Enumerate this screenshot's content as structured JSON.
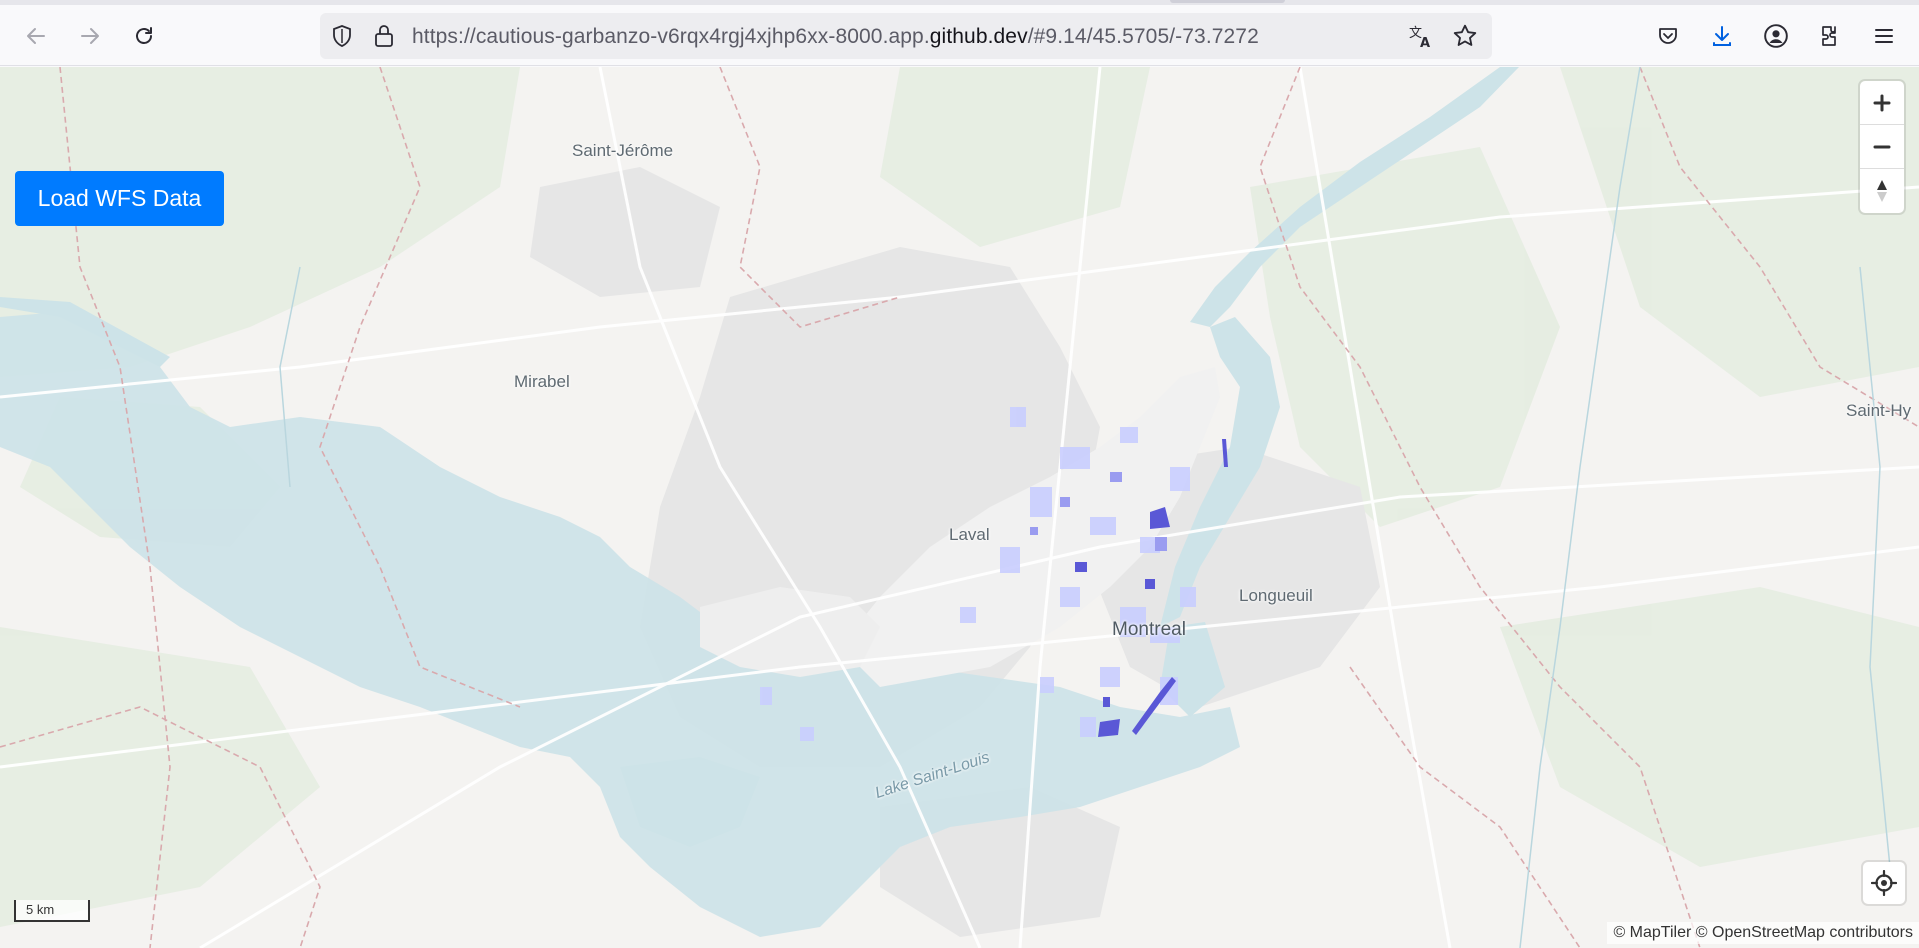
{
  "browser": {
    "url_prefix": "https://cautious-garbanzo-v6rqx4rgj4xjhp6xx-8000.app.",
    "url_domain": "github.dev",
    "url_suffix": "/#9.14/45.5705/-73.7272",
    "icons": {
      "back": "back-arrow-icon",
      "forward": "forward-arrow-icon",
      "reload": "reload-icon",
      "shield": "tracking-protection-shield-icon",
      "lock": "lock-icon",
      "translate": "translate-icon",
      "bookmark": "bookmark-star-icon",
      "pocket": "pocket-icon",
      "downloads": "downloads-icon",
      "account": "account-icon",
      "extensions": "extensions-icon",
      "menu": "hamburger-menu-icon"
    }
  },
  "map": {
    "load_button_label": "Load WFS Data",
    "places": {
      "saint_jerome": "Saint-Jérôme",
      "mirabel": "Mirabel",
      "laval": "Laval",
      "longueuil": "Longueuil",
      "montreal": "Montreal",
      "saint_hy": "Saint-Hy",
      "lake_saint_louis": "Lake Saint-Louis"
    },
    "scale_label": "5 km",
    "attribution_maptiler": "© MapTiler",
    "attribution_osm": "© OpenStreetMap contributors",
    "colors": {
      "water": "#cde3e8",
      "land": "#f4f3f1",
      "urban": "#e7e7e7",
      "feature_light": "#c9ceff",
      "feature_dark": "#5a58d6",
      "button": "#007bff"
    }
  }
}
